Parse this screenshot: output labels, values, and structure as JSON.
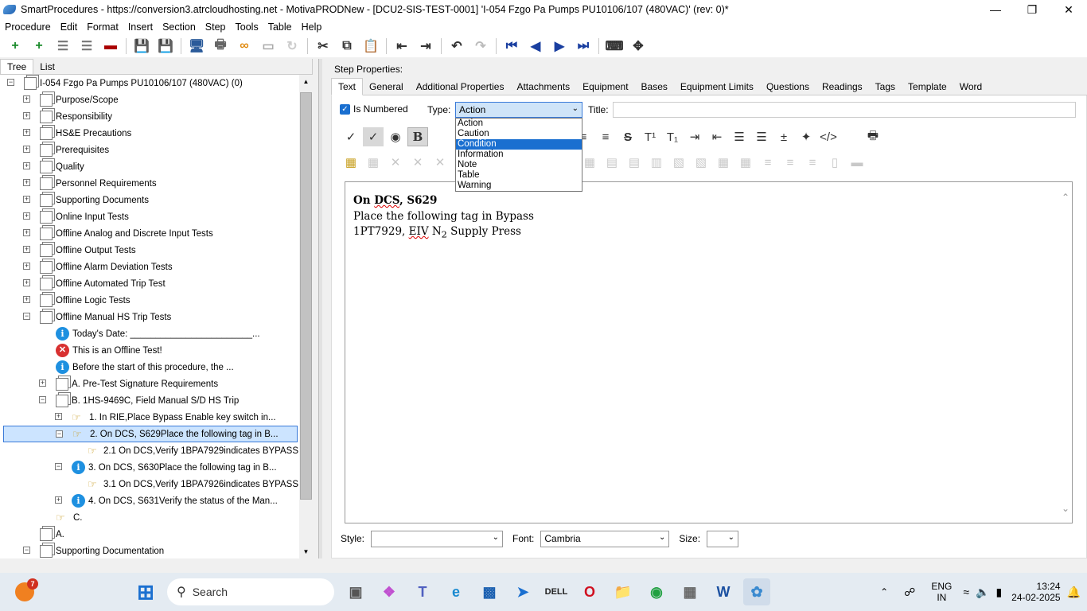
{
  "window": {
    "title": "SmartProcedures - https://conversion3.atrcloudhosting.net - MotivaPRODNew - [DCU2-SIS-TEST-0001] 'I-054 Fzgo Pa Pumps PU10106/107 (480VAC)' (rev: 0)*"
  },
  "menu": [
    "Procedure",
    "Edit",
    "Format",
    "Insert",
    "Section",
    "Step",
    "Tools",
    "Table",
    "Help"
  ],
  "left_tabs": [
    "Tree",
    "List"
  ],
  "tree": [
    {
      "text": "I-054 Fzgo Pa Pumps PU10106/107 (480VAC) (0)",
      "icon": "doc",
      "level": 0,
      "exp": "-"
    },
    {
      "text": "Purpose/Scope",
      "icon": "doc",
      "level": 1,
      "exp": "+"
    },
    {
      "text": "Responsibility",
      "icon": "doc",
      "level": 1,
      "exp": "+"
    },
    {
      "text": "HS&E Precautions",
      "icon": "doc",
      "level": 1,
      "exp": "+"
    },
    {
      "text": "Prerequisites",
      "icon": "doc",
      "level": 1,
      "exp": "+"
    },
    {
      "text": "Quality",
      "icon": "doc",
      "level": 1,
      "exp": "+"
    },
    {
      "text": "Personnel Requirements",
      "icon": "doc",
      "level": 1,
      "exp": "+"
    },
    {
      "text": "Supporting Documents",
      "icon": "doc",
      "level": 1,
      "exp": "+"
    },
    {
      "text": "Online Input Tests",
      "icon": "doc",
      "level": 1,
      "exp": "+"
    },
    {
      "text": "Offline Analog and Discrete Input Tests",
      "icon": "doc",
      "level": 1,
      "exp": "+"
    },
    {
      "text": "Offline Output Tests",
      "icon": "doc",
      "level": 1,
      "exp": "+"
    },
    {
      "text": "Offline Alarm Deviation Tests",
      "icon": "doc",
      "level": 1,
      "exp": "+"
    },
    {
      "text": "Offline Automated Trip Test",
      "icon": "doc",
      "level": 1,
      "exp": "+"
    },
    {
      "text": "Offline Logic Tests",
      "icon": "doc",
      "level": 1,
      "exp": "+"
    },
    {
      "text": "Offline Manual HS Trip Tests",
      "icon": "doc",
      "level": 1,
      "exp": "-"
    },
    {
      "text": "Today's Date: ________________________...",
      "icon": "info",
      "level": 2,
      "exp": ""
    },
    {
      "text": "This is an Offline Test!",
      "icon": "err",
      "level": 2,
      "exp": ""
    },
    {
      "text": "Before the start of this procedure, the ...",
      "icon": "info",
      "level": 2,
      "exp": ""
    },
    {
      "text": "A. Pre-Test Signature Requirements",
      "icon": "doc",
      "level": 2,
      "exp": "+"
    },
    {
      "text": "B. 1HS-9469C, Field Manual S/D HS Trip",
      "icon": "doc",
      "level": 2,
      "exp": "-"
    },
    {
      "text": "1. In RIE,Place Bypass Enable key switch in...",
      "icon": "hand",
      "level": 3,
      "exp": "+"
    },
    {
      "text": "2. On DCS, S629Place the following tag in B...",
      "icon": "hand",
      "level": 3,
      "exp": "-",
      "selected": true
    },
    {
      "text": "2.1 On DCS,Verify 1BPA7929indicates BYPASS",
      "icon": "hand",
      "level": 4,
      "exp": ""
    },
    {
      "text": "3. On DCS, S630Place the following tag in B...",
      "icon": "info",
      "level": 3,
      "exp": "-"
    },
    {
      "text": "3.1 On DCS,Verify 1BPA7926indicates BYPASS",
      "icon": "hand",
      "level": 4,
      "exp": ""
    },
    {
      "text": "4. On DCS, S631Verify the status of the Man...",
      "icon": "info",
      "level": 3,
      "exp": "+"
    },
    {
      "text": "C.",
      "icon": "hand",
      "level": 2,
      "exp": ""
    },
    {
      "text": "A.",
      "icon": "doc",
      "level": 1,
      "exp": ""
    },
    {
      "text": "Supporting Documentation",
      "icon": "doc",
      "level": 1,
      "exp": "-"
    }
  ],
  "step": {
    "props_label": "Step Properties:",
    "tabs": [
      "Text",
      "General",
      "Additional Properties",
      "Attachments",
      "Equipment",
      "Bases",
      "Equipment Limits",
      "Questions",
      "Readings",
      "Tags",
      "Template",
      "Word"
    ],
    "is_numbered_label": "Is Numbered",
    "type_label": "Type:",
    "type_value": "Action",
    "title_label": "Title:",
    "type_options": [
      "Action",
      "Caution",
      "Condition",
      "Information",
      "Note",
      "Table",
      "Warning"
    ],
    "highlighted_option": "Condition",
    "text_line1_a": "On ",
    "text_line1_b": "DCS",
    "text_line1_c": ", S629",
    "text_line2": "Place the following tag in Bypass",
    "text_line3_a": "1PT7929, ",
    "text_line3_b": "EIV",
    "text_line3_c": " N",
    "text_line3_sub": "2",
    "text_line3_d": " Supply Press",
    "style_label": "Style:",
    "style_value": "",
    "font_label": "Font:",
    "font_value": "Cambria",
    "size_label": "Size:",
    "size_value": ""
  },
  "taskbar": {
    "search": "Search",
    "badge": "7",
    "lang1": "ENG",
    "lang2": "IN",
    "time": "13:24",
    "date": "24-02-2025"
  }
}
